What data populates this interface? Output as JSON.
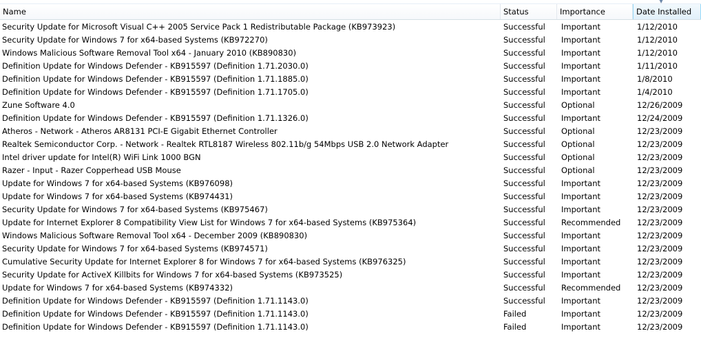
{
  "columns": {
    "name": "Name",
    "status": "Status",
    "importance": "Importance",
    "date_installed": "Date Installed"
  },
  "sort": {
    "column": "date_installed",
    "direction": "descending",
    "icon": "sort-down-arrow"
  },
  "rows": [
    {
      "name": "Security Update for Microsoft Visual C++ 2005 Service Pack 1 Redistributable Package (KB973923)",
      "status": "Successful",
      "importance": "Important",
      "date": "1/12/2010"
    },
    {
      "name": "Security Update for Windows 7 for x64-based Systems (KB972270)",
      "status": "Successful",
      "importance": "Important",
      "date": "1/12/2010"
    },
    {
      "name": "Windows Malicious Software Removal Tool x64 - January 2010 (KB890830)",
      "status": "Successful",
      "importance": "Important",
      "date": "1/12/2010"
    },
    {
      "name": "Definition Update for Windows Defender - KB915597 (Definition 1.71.2030.0)",
      "status": "Successful",
      "importance": "Important",
      "date": "1/11/2010"
    },
    {
      "name": "Definition Update for Windows Defender - KB915597 (Definition 1.71.1885.0)",
      "status": "Successful",
      "importance": "Important",
      "date": "1/8/2010"
    },
    {
      "name": "Definition Update for Windows Defender - KB915597 (Definition 1.71.1705.0)",
      "status": "Successful",
      "importance": "Important",
      "date": "1/4/2010"
    },
    {
      "name": "Zune Software 4.0",
      "status": "Successful",
      "importance": "Optional",
      "date": "12/26/2009"
    },
    {
      "name": "Definition Update for Windows Defender - KB915597 (Definition 1.71.1326.0)",
      "status": "Successful",
      "importance": "Important",
      "date": "12/24/2009"
    },
    {
      "name": "Atheros - Network - Atheros AR8131 PCI-E Gigabit Ethernet Controller",
      "status": "Successful",
      "importance": "Optional",
      "date": "12/23/2009"
    },
    {
      "name": "Realtek Semiconductor Corp. - Network - Realtek RTL8187 Wireless 802.11b/g 54Mbps USB 2.0 Network Adapter",
      "status": "Successful",
      "importance": "Optional",
      "date": "12/23/2009"
    },
    {
      "name": "Intel driver update for Intel(R) WiFi Link 1000 BGN",
      "status": "Successful",
      "importance": "Optional",
      "date": "12/23/2009"
    },
    {
      "name": "Razer - Input - Razer Copperhead USB Mouse",
      "status": "Successful",
      "importance": "Optional",
      "date": "12/23/2009"
    },
    {
      "name": "Update for Windows 7 for x64-based Systems (KB976098)",
      "status": "Successful",
      "importance": "Important",
      "date": "12/23/2009"
    },
    {
      "name": "Update for Windows 7 for x64-based Systems (KB974431)",
      "status": "Successful",
      "importance": "Important",
      "date": "12/23/2009"
    },
    {
      "name": "Security Update for Windows 7 for x64-based Systems (KB975467)",
      "status": "Successful",
      "importance": "Important",
      "date": "12/23/2009"
    },
    {
      "name": "Update for Internet Explorer 8 Compatibility View List for Windows 7 for x64-based Systems (KB975364)",
      "status": "Successful",
      "importance": "Recommended",
      "date": "12/23/2009"
    },
    {
      "name": "Windows Malicious Software Removal Tool x64 - December 2009 (KB890830)",
      "status": "Successful",
      "importance": "Important",
      "date": "12/23/2009"
    },
    {
      "name": "Security Update for Windows 7 for x64-based Systems (KB974571)",
      "status": "Successful",
      "importance": "Important",
      "date": "12/23/2009"
    },
    {
      "name": "Cumulative Security Update for Internet Explorer 8 for Windows 7 for x64-based Systems (KB976325)",
      "status": "Successful",
      "importance": "Important",
      "date": "12/23/2009"
    },
    {
      "name": "Security Update for ActiveX Killbits for Windows 7 for x64-based Systems (KB973525)",
      "status": "Successful",
      "importance": "Important",
      "date": "12/23/2009"
    },
    {
      "name": "Update for Windows 7 for x64-based Systems (KB974332)",
      "status": "Successful",
      "importance": "Recommended",
      "date": "12/23/2009"
    },
    {
      "name": "Definition Update for Windows Defender - KB915597 (Definition 1.71.1143.0)",
      "status": "Successful",
      "importance": "Important",
      "date": "12/23/2009"
    },
    {
      "name": "Definition Update for Windows Defender - KB915597 (Definition 1.71.1143.0)",
      "status": "Failed",
      "importance": "Important",
      "date": "12/23/2009"
    },
    {
      "name": "Definition Update for Windows Defender - KB915597 (Definition 1.71.1143.0)",
      "status": "Failed",
      "importance": "Important",
      "date": "12/23/2009"
    }
  ]
}
